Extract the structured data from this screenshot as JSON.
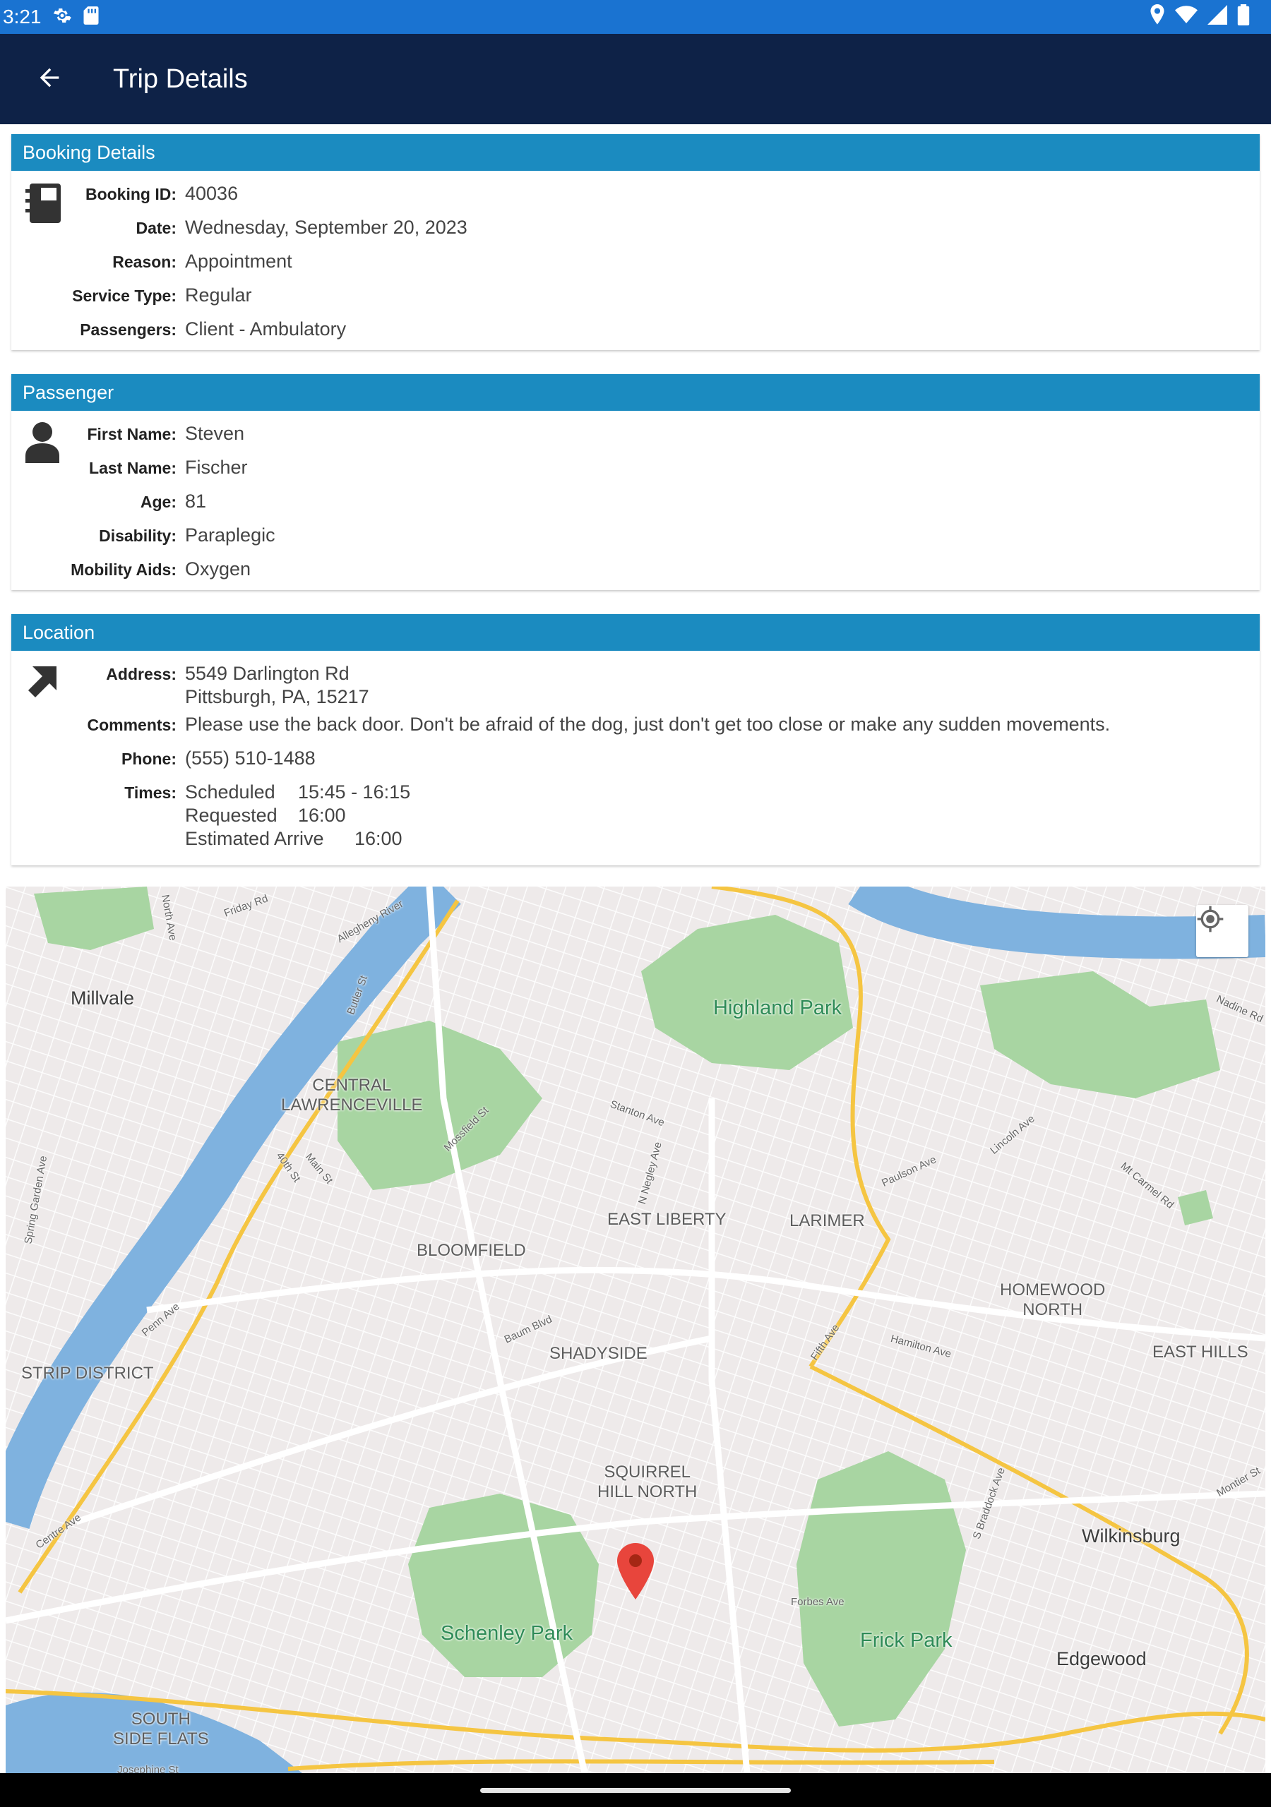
{
  "status_bar": {
    "time": "3:21",
    "icons_left": [
      "settings-icon",
      "sd-card-icon"
    ],
    "icons_right": [
      "location-icon",
      "wifi-icon",
      "signal-icon",
      "battery-icon"
    ]
  },
  "app_bar": {
    "title": "Trip Details",
    "back_icon": "arrow-back-icon"
  },
  "booking": {
    "header": "Booking Details",
    "icon": "booklet-icon",
    "rows": [
      {
        "label": "Booking ID:",
        "value": "40036"
      },
      {
        "label": "Date:",
        "value": "Wednesday, September 20, 2023"
      },
      {
        "label": "Reason:",
        "value": "Appointment"
      },
      {
        "label": "Service Type:",
        "value": "Regular"
      },
      {
        "label": "Passengers:",
        "value": "Client - Ambulatory"
      }
    ]
  },
  "passenger": {
    "header": "Passenger",
    "icon": "person-icon",
    "rows": [
      {
        "label": "First Name:",
        "value": "Steven"
      },
      {
        "label": "Last Name:",
        "value": "Fischer"
      },
      {
        "label": "Age:",
        "value": "81"
      },
      {
        "label": "Disability:",
        "value": "Paraplegic"
      },
      {
        "label": "Mobility Aids:",
        "value": "Oxygen"
      }
    ]
  },
  "location": {
    "header": "Location",
    "icon": "arrow-up-right-icon",
    "address_label": "Address:",
    "address_line1": "5549 Darlington Rd",
    "address_line2": "Pittsburgh, PA, 15217",
    "comments_label": "Comments:",
    "comments": "Please use the back door. Don't be afraid of the dog, just don't get too close or make any sudden movements.",
    "phone_label": "Phone:",
    "phone": "(555) 510-1488",
    "times_label": "Times:",
    "times": [
      {
        "name": "Scheduled",
        "value": "15:45 - 16:15"
      },
      {
        "name": "Requested",
        "value": "16:00"
      },
      {
        "name": "Estimated Arrive",
        "value": "16:00"
      }
    ]
  },
  "map": {
    "labels": {
      "millvale": "Millvale",
      "highland_park": "Highland Park",
      "central_lawrenceville": "CENTRAL\nLAWRENCEVILLE",
      "east_liberty": "EAST LIBERTY",
      "larimer": "LARIMER",
      "bloomfield": "BLOOMFIELD",
      "homewood_north": "HOMEWOOD\nNORTH",
      "strip_district": "STRIP DISTRICT",
      "shadyside": "SHADYSIDE",
      "east_hills": "EAST HILLS",
      "squirrel_hill_north": "SQUIRREL\nHILL NORTH",
      "wilkinsburg": "Wilkinsburg",
      "schenley_park": "Schenley Park",
      "frick_park": "Frick Park",
      "edgewood": "Edgewood",
      "south_side_flats": "SOUTH\nSIDE FLATS"
    },
    "streets": {
      "friday_rd": "Friday Rd",
      "north_ave": "North Ave",
      "allegheny_river": "Allegheny River",
      "butler_st": "Butler St",
      "nadine_rd": "Nadine Rd",
      "stanton_ave": "Stanton Ave",
      "mossfield_st": "Mossfield St",
      "n_negley_ave": "N Negley Ave",
      "paulson_ave": "Paulson Ave",
      "lincoln_ave": "Lincoln Ave",
      "mt_carmel_rd": "Mt Carmel Rd",
      "spring_garden_ave": "Spring Garden Ave",
      "fortieth_st": "40th St",
      "main_st": "Main St",
      "penn_ave": "Penn Ave",
      "baum_blvd": "Baum Blvd",
      "fifth_ave": "Fifth Ave",
      "hamilton_ave": "Hamilton Ave",
      "s_braddock_ave": "S Braddock Ave",
      "montier_st": "Montier St",
      "centre_ave": "Centre Ave",
      "forbes_ave": "Forbes Ave",
      "josephine_st": "Josephine St"
    },
    "locate_icon": "my-location-icon",
    "pin_icon": "map-pin-icon",
    "colors": {
      "water": "#5b9bd5",
      "park": "#a8d5a2",
      "highway": "#f5c542",
      "land": "#eeeaea"
    }
  },
  "colors": {
    "status_bar": "#1a73d1",
    "app_bar": "#0e2247",
    "section_header": "#1b8bc0"
  }
}
